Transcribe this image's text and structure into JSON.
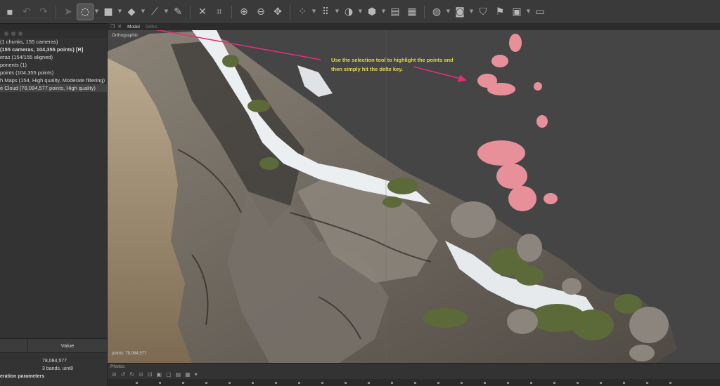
{
  "toolbar": {
    "icons": [
      "save-icon",
      "undo-icon",
      "redo-icon",
      "navigation-arrow-icon",
      "rotate-selection-icon",
      "rectangle-selection-icon",
      "shape-icon",
      "ruler-icon",
      "eraser-icon",
      "delete-icon",
      "crop-icon",
      "zoom-in-icon",
      "zoom-out-icon",
      "move-icon",
      "point-cloud-icon",
      "dense-cloud-icon",
      "mesh-icon",
      "solid-icon",
      "texture-icon",
      "globe-icon",
      "camera-icon",
      "shield-icon",
      "flag-icon",
      "image-icon",
      "grid-icon"
    ]
  },
  "workspace": {
    "items": [
      "(1 chunks, 155 cameras)",
      "(155 cameras, 104,355 points) [R]",
      "eras (154/155 aligned)",
      "ponents (1)",
      "points (104,355 points)",
      "h Maps (154, High quality, Moderate filtering)",
      "e Cloud (78,084,577 points, High quality)"
    ]
  },
  "viewport": {
    "tabs": [
      "Model",
      "Ortho"
    ],
    "projection": "Orthographic",
    "points_readout": "points: 78,084,577",
    "annotation_line1": "Use the selection tool to highlight the points and",
    "annotation_line2": "then simply hit the delte key.",
    "annotation_color": "#e8d84a",
    "arrow_color": "#e0307a",
    "selection_color": "#e8909a"
  },
  "properties": {
    "header_value": "Value",
    "rows": [
      "78,084,577",
      "3 bands, uint8"
    ],
    "section": "eration parameters"
  },
  "photos": {
    "title": "Photos"
  }
}
